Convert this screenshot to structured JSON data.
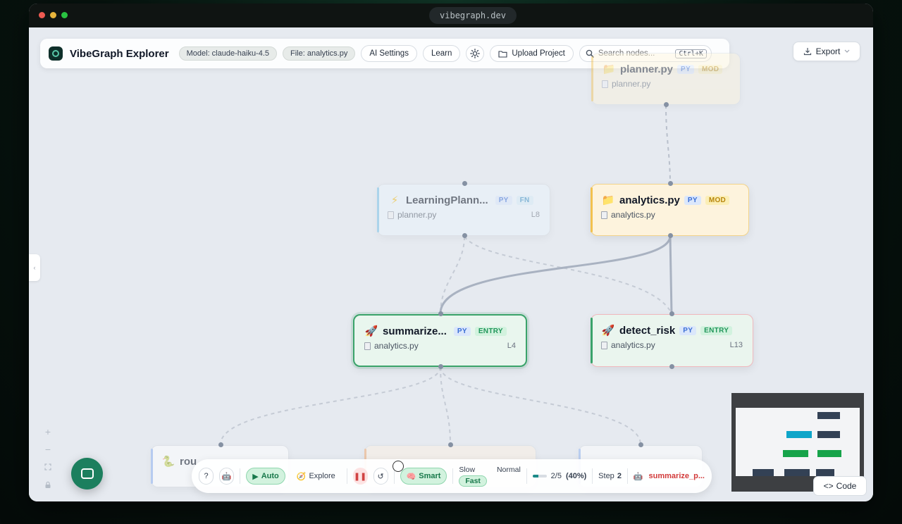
{
  "browser": {
    "url": "vibegraph.dev"
  },
  "toolbar": {
    "app_title": "VibeGraph Explorer",
    "model_pill": "Model: claude-haiku-4.5",
    "file_pill": "File: analytics.py",
    "ai_settings_label": "AI Settings",
    "learn_label": "Learn",
    "upload_label": "Upload Project",
    "search_placeholder": "Search nodes...",
    "search_shortcut": "Ctrl+K"
  },
  "export_label": "Export",
  "nodes": {
    "planner_top": {
      "title": "planner.py",
      "badge1": "PY",
      "badge2": "MOD",
      "file": "planner.py"
    },
    "learning_planner": {
      "title": "LearningPlann...",
      "badge1": "PY",
      "badge2": "FN",
      "file": "planner.py",
      "line": "L8"
    },
    "analytics": {
      "title": "analytics.py",
      "badge1": "PY",
      "badge2": "MOD",
      "file": "analytics.py"
    },
    "summarize": {
      "title": "summarize...",
      "badge1": "PY",
      "badge2": "ENTRY",
      "file": "analytics.py",
      "line": "L4"
    },
    "detect_risk": {
      "title": "detect_risk",
      "badge1": "PY",
      "badge2": "ENTRY",
      "file": "analytics.py",
      "line": "L13"
    },
    "route": {
      "title": "rou"
    }
  },
  "controls": {
    "help_label": "?",
    "auto_label": "Auto",
    "explore_label": "Explore",
    "smart_label": "Smart",
    "speed_slow": "Slow",
    "speed_normal": "Normal",
    "speed_fast": "Fast",
    "progress_text": "2/5",
    "progress_percent": "(40%)",
    "progress_fraction": 0.4,
    "step_label": "Step",
    "step_value": "2",
    "current_node": "summarize_p..."
  },
  "code_label": "Code",
  "colors": {
    "accent_green": "#1c7f5e",
    "module_yellow": "#f2c14e",
    "entry_green": "#3aa36a",
    "function_blue": "#7cc3e8",
    "edge_gray": "#a3acbb"
  }
}
